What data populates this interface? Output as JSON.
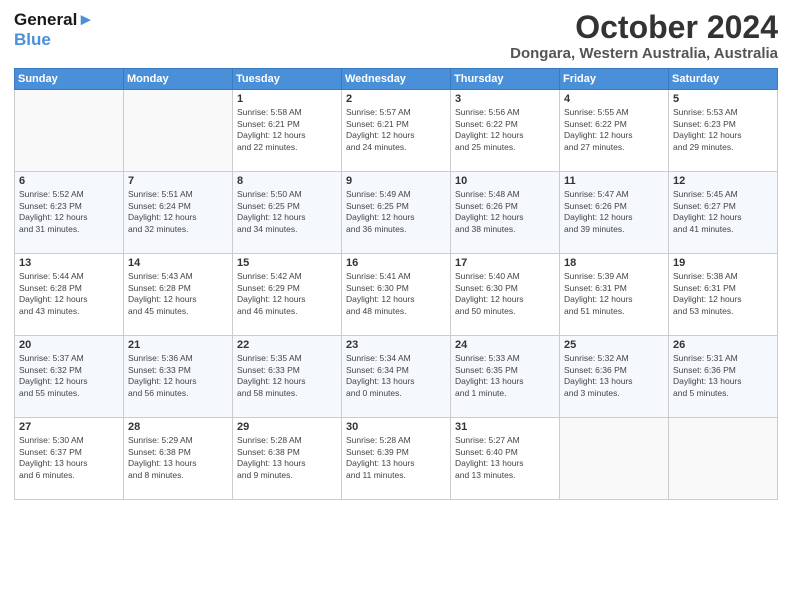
{
  "logo": {
    "line1": "General",
    "line2": "Blue"
  },
  "title": "October 2024",
  "subtitle": "Dongara, Western Australia, Australia",
  "days_header": [
    "Sunday",
    "Monday",
    "Tuesday",
    "Wednesday",
    "Thursday",
    "Friday",
    "Saturday"
  ],
  "weeks": [
    [
      {
        "day": "",
        "info": ""
      },
      {
        "day": "",
        "info": ""
      },
      {
        "day": "1",
        "info": "Sunrise: 5:58 AM\nSunset: 6:21 PM\nDaylight: 12 hours\nand 22 minutes."
      },
      {
        "day": "2",
        "info": "Sunrise: 5:57 AM\nSunset: 6:21 PM\nDaylight: 12 hours\nand 24 minutes."
      },
      {
        "day": "3",
        "info": "Sunrise: 5:56 AM\nSunset: 6:22 PM\nDaylight: 12 hours\nand 25 minutes."
      },
      {
        "day": "4",
        "info": "Sunrise: 5:55 AM\nSunset: 6:22 PM\nDaylight: 12 hours\nand 27 minutes."
      },
      {
        "day": "5",
        "info": "Sunrise: 5:53 AM\nSunset: 6:23 PM\nDaylight: 12 hours\nand 29 minutes."
      }
    ],
    [
      {
        "day": "6",
        "info": "Sunrise: 5:52 AM\nSunset: 6:23 PM\nDaylight: 12 hours\nand 31 minutes."
      },
      {
        "day": "7",
        "info": "Sunrise: 5:51 AM\nSunset: 6:24 PM\nDaylight: 12 hours\nand 32 minutes."
      },
      {
        "day": "8",
        "info": "Sunrise: 5:50 AM\nSunset: 6:25 PM\nDaylight: 12 hours\nand 34 minutes."
      },
      {
        "day": "9",
        "info": "Sunrise: 5:49 AM\nSunset: 6:25 PM\nDaylight: 12 hours\nand 36 minutes."
      },
      {
        "day": "10",
        "info": "Sunrise: 5:48 AM\nSunset: 6:26 PM\nDaylight: 12 hours\nand 38 minutes."
      },
      {
        "day": "11",
        "info": "Sunrise: 5:47 AM\nSunset: 6:26 PM\nDaylight: 12 hours\nand 39 minutes."
      },
      {
        "day": "12",
        "info": "Sunrise: 5:45 AM\nSunset: 6:27 PM\nDaylight: 12 hours\nand 41 minutes."
      }
    ],
    [
      {
        "day": "13",
        "info": "Sunrise: 5:44 AM\nSunset: 6:28 PM\nDaylight: 12 hours\nand 43 minutes."
      },
      {
        "day": "14",
        "info": "Sunrise: 5:43 AM\nSunset: 6:28 PM\nDaylight: 12 hours\nand 45 minutes."
      },
      {
        "day": "15",
        "info": "Sunrise: 5:42 AM\nSunset: 6:29 PM\nDaylight: 12 hours\nand 46 minutes."
      },
      {
        "day": "16",
        "info": "Sunrise: 5:41 AM\nSunset: 6:30 PM\nDaylight: 12 hours\nand 48 minutes."
      },
      {
        "day": "17",
        "info": "Sunrise: 5:40 AM\nSunset: 6:30 PM\nDaylight: 12 hours\nand 50 minutes."
      },
      {
        "day": "18",
        "info": "Sunrise: 5:39 AM\nSunset: 6:31 PM\nDaylight: 12 hours\nand 51 minutes."
      },
      {
        "day": "19",
        "info": "Sunrise: 5:38 AM\nSunset: 6:31 PM\nDaylight: 12 hours\nand 53 minutes."
      }
    ],
    [
      {
        "day": "20",
        "info": "Sunrise: 5:37 AM\nSunset: 6:32 PM\nDaylight: 12 hours\nand 55 minutes."
      },
      {
        "day": "21",
        "info": "Sunrise: 5:36 AM\nSunset: 6:33 PM\nDaylight: 12 hours\nand 56 minutes."
      },
      {
        "day": "22",
        "info": "Sunrise: 5:35 AM\nSunset: 6:33 PM\nDaylight: 12 hours\nand 58 minutes."
      },
      {
        "day": "23",
        "info": "Sunrise: 5:34 AM\nSunset: 6:34 PM\nDaylight: 13 hours\nand 0 minutes."
      },
      {
        "day": "24",
        "info": "Sunrise: 5:33 AM\nSunset: 6:35 PM\nDaylight: 13 hours\nand 1 minute."
      },
      {
        "day": "25",
        "info": "Sunrise: 5:32 AM\nSunset: 6:36 PM\nDaylight: 13 hours\nand 3 minutes."
      },
      {
        "day": "26",
        "info": "Sunrise: 5:31 AM\nSunset: 6:36 PM\nDaylight: 13 hours\nand 5 minutes."
      }
    ],
    [
      {
        "day": "27",
        "info": "Sunrise: 5:30 AM\nSunset: 6:37 PM\nDaylight: 13 hours\nand 6 minutes."
      },
      {
        "day": "28",
        "info": "Sunrise: 5:29 AM\nSunset: 6:38 PM\nDaylight: 13 hours\nand 8 minutes."
      },
      {
        "day": "29",
        "info": "Sunrise: 5:28 AM\nSunset: 6:38 PM\nDaylight: 13 hours\nand 9 minutes."
      },
      {
        "day": "30",
        "info": "Sunrise: 5:28 AM\nSunset: 6:39 PM\nDaylight: 13 hours\nand 11 minutes."
      },
      {
        "day": "31",
        "info": "Sunrise: 5:27 AM\nSunset: 6:40 PM\nDaylight: 13 hours\nand 13 minutes."
      },
      {
        "day": "",
        "info": ""
      },
      {
        "day": "",
        "info": ""
      }
    ]
  ]
}
